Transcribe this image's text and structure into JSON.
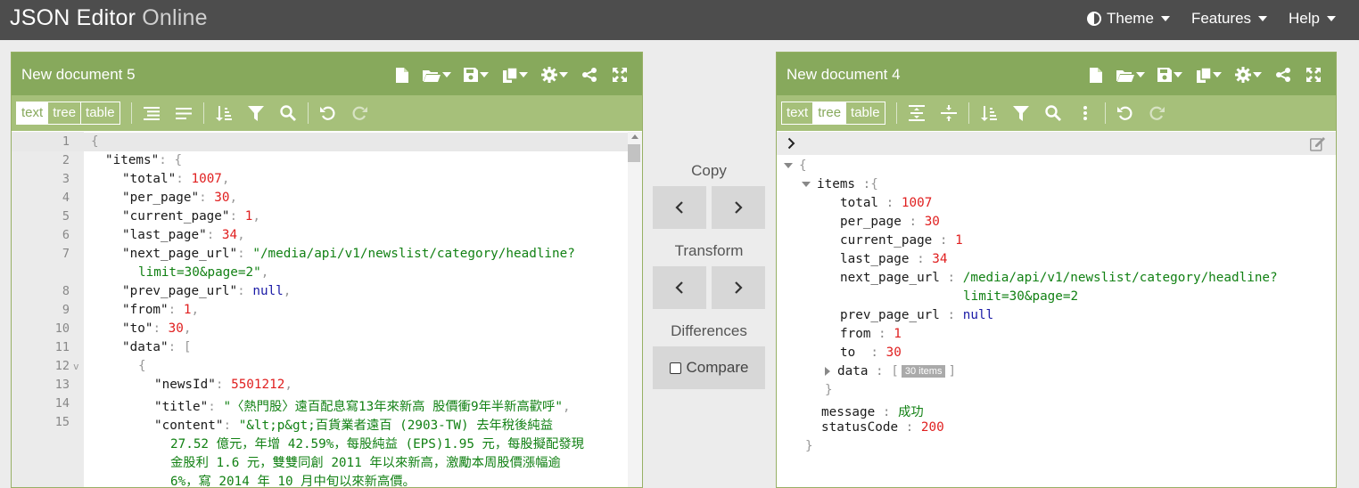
{
  "app": {
    "title_bold": "JSON Editor",
    "title_light": " Online"
  },
  "topmenu": {
    "theme": "Theme",
    "features": "Features",
    "help": "Help"
  },
  "left": {
    "title": "New document 5",
    "modes": [
      "text",
      "tree",
      "table"
    ],
    "active_mode": "text",
    "line_numbers": [
      "1",
      "2",
      "3",
      "4",
      "5",
      "6",
      "7",
      "",
      "8",
      "9",
      "10",
      "11",
      "12",
      "13",
      "14",
      "15"
    ],
    "fold_marker": "v"
  },
  "middle": {
    "copy_label": "Copy",
    "transform_label": "Transform",
    "differences_label": "Differences",
    "compare_label": "Compare"
  },
  "right": {
    "title": "New document 4",
    "modes": [
      "text",
      "tree",
      "table"
    ],
    "active_mode": "tree",
    "root_open": "{",
    "root_close": "}",
    "items_key": "items",
    "items_close": "}",
    "fields": {
      "total": {
        "key": "total",
        "value": "1007"
      },
      "per_page": {
        "key": "per_page",
        "value": "30"
      },
      "current_page": {
        "key": "current_page",
        "value": "1"
      },
      "last_page": {
        "key": "last_page",
        "value": "34"
      },
      "next_page_url": {
        "key": "next_page_url",
        "value1": "/media/api/v1/newslist/category/headline?",
        "value2": "limit=30&page=2"
      },
      "prev_page_url": {
        "key": "prev_page_url",
        "value": "null"
      },
      "from": {
        "key": "from",
        "value": "1"
      },
      "to": {
        "key": "to",
        "value": "30"
      },
      "data": {
        "key": "data",
        "badge": "30 items"
      }
    },
    "message": {
      "key": "message",
      "value": "成功"
    },
    "statusCode": {
      "key": "statusCode",
      "value": "200"
    }
  },
  "code": {
    "l1": "{",
    "l2_key": "\"items\"",
    "l3": {
      "key": "\"total\"",
      "val": "1007"
    },
    "l4": {
      "key": "\"per_page\"",
      "val": "30"
    },
    "l5": {
      "key": "\"current_page\"",
      "val": "1"
    },
    "l6": {
      "key": "\"last_page\"",
      "val": "34"
    },
    "l7": {
      "key": "\"next_page_url\"",
      "val1": "\"/media/api/v1/newslist/category/headline?",
      "val2": "limit=30&page=2\""
    },
    "l8": {
      "key": "\"prev_page_url\"",
      "val": "null"
    },
    "l9": {
      "key": "\"from\"",
      "val": "1"
    },
    "l10": {
      "key": "\"to\"",
      "val": "30"
    },
    "l11": {
      "key": "\"data\""
    },
    "l12": "{",
    "l13": {
      "key": "\"newsId\"",
      "val": "5501212"
    },
    "l14": {
      "key": "\"title\"",
      "val": "\"〈熱門股〉遠百配息寫13年來新高 股價衝9年半新高歡呼\""
    },
    "l15": {
      "key": "\"content\"",
      "val1": "\"&lt;p&gt;百貨業者遠百 (2903-TW) 去年稅後純益",
      "val2": "27.52 億元，年增 42.59%，每股純益 (EPS)1.95 元，每股擬配發現",
      "val3": "金股利 1.6 元，雙雙同創 2011 年以來新高，激勵本周股價漲幅逾",
      "val4": "6%，寫 2014 年 10 月中旬以來新高價。"
    }
  }
}
